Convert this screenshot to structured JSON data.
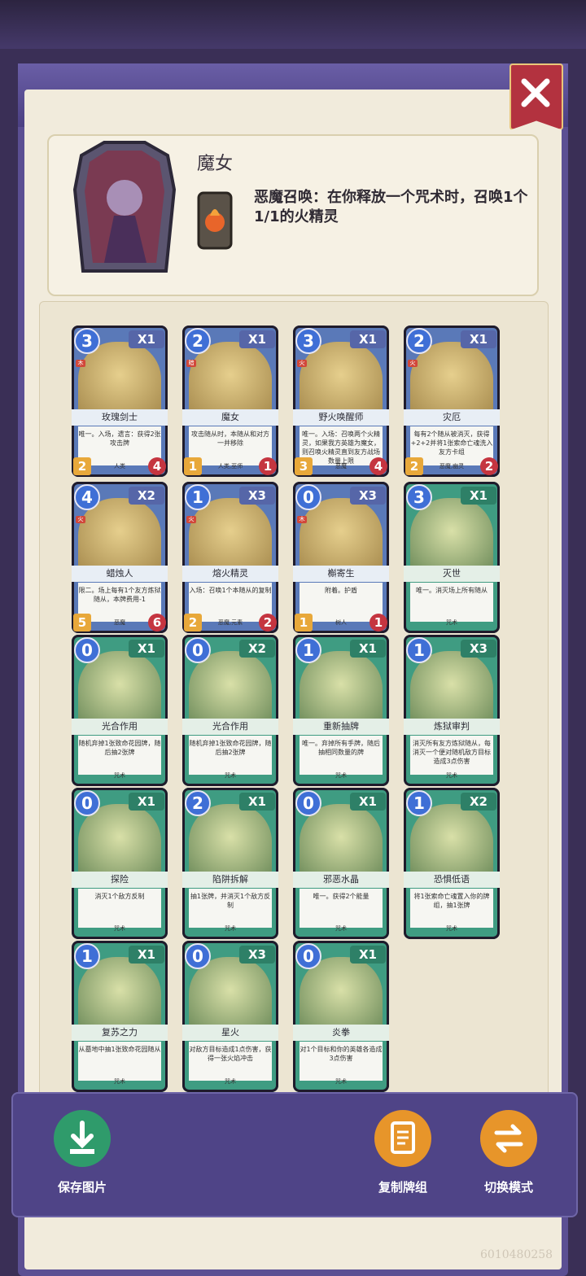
{
  "hero": {
    "name": "魔女",
    "skill": "恶魔召唤：在你释放一个咒术时，召唤1个1/1的火精灵"
  },
  "colors": {
    "frame": "#5b4f93",
    "paper": "#f1ebdc",
    "close": "#b3323f",
    "spell": "#3f9c82",
    "minion": "#5a79b8"
  },
  "cards": [
    {
      "cost": "3",
      "count": "X1",
      "name": "玫瑰剑士",
      "desc": "唯一。入场，遗言：获得2张攻击牌",
      "type": "人类",
      "atk": "2",
      "hp": "4",
      "kind": "minion",
      "tag": "木"
    },
    {
      "cost": "2",
      "count": "X1",
      "name": "魔女",
      "desc": "攻击随从时，本随从和对方一并移除",
      "type": "人类,巫师",
      "atk": "1",
      "hp": "1",
      "kind": "minion",
      "tag": "暗"
    },
    {
      "cost": "3",
      "count": "X1",
      "name": "野火唤醒师",
      "desc": "唯一。入场：召唤两个火精灵，如果我方英雄为魔女，则召唤火精灵直到友方战场数量上限",
      "type": "恶魔",
      "atk": "3",
      "hp": "4",
      "kind": "minion",
      "tag": "火"
    },
    {
      "cost": "2",
      "count": "X1",
      "name": "灾厄",
      "desc": "每有2个随从被消灭，获得+2+2并将1张索命亡魂洗入友方卡组",
      "type": "恶魔,幽灵",
      "atk": "2",
      "hp": "2",
      "kind": "minion",
      "tag": "火"
    },
    {
      "cost": "4",
      "count": "X2",
      "name": "蜡烛人",
      "desc": "限二。场上每有1个友方炼狱随从，本牌费用-1",
      "type": "恶魔",
      "atk": "5",
      "hp": "6",
      "kind": "minion",
      "tag": "火"
    },
    {
      "cost": "1",
      "count": "X3",
      "name": "熔火精灵",
      "desc": "入场：召唤1个本随从的复制",
      "type": "恶魔,元素",
      "atk": "2",
      "hp": "2",
      "kind": "minion",
      "tag": "火"
    },
    {
      "cost": "0",
      "count": "X3",
      "name": "槲寄生",
      "desc": "附着。护盾",
      "type": "树人",
      "atk": "1",
      "hp": "1",
      "kind": "minion",
      "tag": "木"
    },
    {
      "cost": "3",
      "count": "X1",
      "name": "灭世",
      "desc": "唯一。消灭场上所有随从",
      "type": "咒术",
      "kind": "spell"
    },
    {
      "cost": "0",
      "count": "X1",
      "name": "光合作用",
      "desc": "随机弃掉1张致命花园牌，随后抽2张牌",
      "type": "咒术",
      "kind": "spell"
    },
    {
      "cost": "0",
      "count": "X2",
      "name": "光合作用",
      "desc": "随机弃掉1张致命花园牌，随后抽2张牌",
      "type": "咒术",
      "kind": "spell"
    },
    {
      "cost": "1",
      "count": "X1",
      "name": "重新抽牌",
      "desc": "唯一。弃掉所有手牌，随后抽相同数量的牌",
      "type": "咒术",
      "kind": "spell"
    },
    {
      "cost": "1",
      "count": "X3",
      "name": "炼狱审判",
      "desc": "消灭所有友方炼狱随从，每消灭一个便对随机敌方目标造成3点伤害",
      "type": "咒术",
      "kind": "spell"
    },
    {
      "cost": "0",
      "count": "X1",
      "name": "探险",
      "desc": "消灭1个敌方反制",
      "type": "咒术",
      "kind": "spell"
    },
    {
      "cost": "2",
      "count": "X1",
      "name": "陷阱拆解",
      "desc": "抽1张牌，并消灭1个敌方反制",
      "type": "咒术",
      "kind": "spell"
    },
    {
      "cost": "0",
      "count": "X1",
      "name": "邪恶水晶",
      "desc": "唯一。获得2个能量",
      "type": "咒术",
      "kind": "spell"
    },
    {
      "cost": "1",
      "count": "X2",
      "name": "恐惧低语",
      "desc": "将1张索命亡魂置入你的牌组，抽1张牌",
      "type": "咒术",
      "kind": "spell"
    },
    {
      "cost": "1",
      "count": "X1",
      "name": "复苏之力",
      "desc": "从墓地中抽1张致命花园随从",
      "type": "咒术",
      "kind": "spell"
    },
    {
      "cost": "0",
      "count": "X3",
      "name": "星火",
      "desc": "对敌方目标造成1点伤害，获得一张火焰冲击",
      "type": "咒术",
      "kind": "spell"
    },
    {
      "cost": "0",
      "count": "X1",
      "name": "炎拳",
      "desc": "对1个目标和你的英雄各造成3点伤害",
      "type": "咒术",
      "kind": "spell"
    }
  ],
  "buttons": {
    "save": "保存图片",
    "copy": "复制牌组",
    "switch": "切换模式"
  },
  "watermark": "6010480258"
}
